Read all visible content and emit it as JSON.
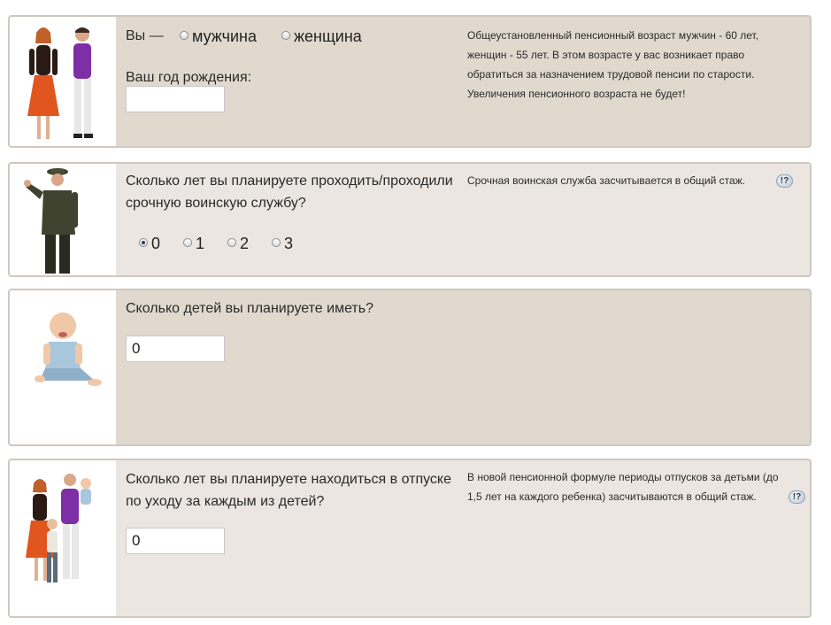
{
  "sections": [
    {
      "gender_prefix": "Вы —",
      "gender_options": [
        {
          "label": "мужчина",
          "checked": false
        },
        {
          "label": "женщина",
          "checked": false
        }
      ],
      "birth_year_label": "Ваш год рождения:",
      "birth_year_value": "",
      "note": "Общеустановленный пенсионный возраст мужчин - 60 лет, женщин - 55 лет. В этом возрасте у вас возникает право обратиться за назначением трудовой пенсии по старости. Увеличения пенсионного возраста не будет!"
    },
    {
      "question": "Сколько лет вы планируете проходить/проходили срочную воинскую службу?",
      "options": [
        {
          "label": "0",
          "checked": true
        },
        {
          "label": "1",
          "checked": false
        },
        {
          "label": "2",
          "checked": false
        },
        {
          "label": "3",
          "checked": false
        }
      ],
      "note": "Срочная воинская служба засчитывается в общий стаж.",
      "help_icon": "!?"
    },
    {
      "question": "Сколько детей вы планируете иметь?",
      "value": "0"
    },
    {
      "question": "Сколько лет вы планируете находиться в отпуске по уходу за каждым из детей?",
      "value": "0",
      "note": "В новой пенсионной формуле периоды отпусков за детьми (до 1,5 лет на каждого ребенка) засчитываются в общий стаж.",
      "help_icon": "!?"
    }
  ],
  "colors": {
    "card_beige": "#e1d9ce",
    "card_light": "#ebe6e1",
    "card_border": "#cfc8bf"
  },
  "icons": [
    "couple-photo",
    "soldier-photo",
    "baby-photo",
    "family-photo",
    "help-icon"
  ]
}
